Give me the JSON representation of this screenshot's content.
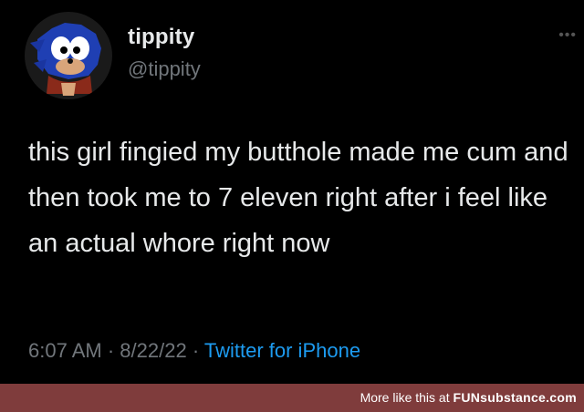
{
  "tweet": {
    "display_name": "tippity",
    "handle": "@tippity",
    "text": "this girl fingied my butthole made me cum and then took me to 7 eleven right after i feel like an actual whore right now",
    "time": "6:07 AM",
    "separator": "·",
    "date": "8/22/22",
    "source": "Twitter for iPhone",
    "more_icon": "more-horizontal-icon",
    "avatar_icon": "sonic-avatar"
  },
  "watermark": {
    "prefix": "More like this at ",
    "brand": "FUNsubstance.com"
  },
  "colors": {
    "background": "#000000",
    "text": "#e7e9ea",
    "muted": "#71767b",
    "link": "#1d9bf0",
    "footer": "#7f3c3c"
  }
}
